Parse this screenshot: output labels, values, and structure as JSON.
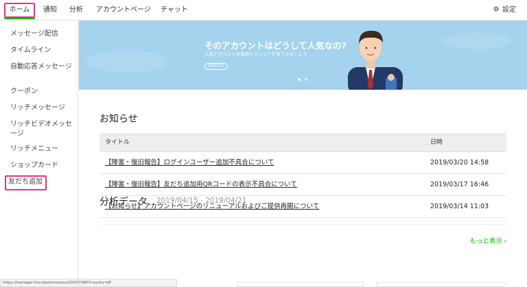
{
  "topnav": {
    "tabs": [
      {
        "label": "ホーム"
      },
      {
        "label": "通知"
      },
      {
        "label": "分析"
      },
      {
        "label": "アカウントページ"
      },
      {
        "label": "チャット"
      }
    ],
    "settings_label": "設定",
    "colors": {
      "highlight": "#e6337a",
      "active_underline": "#00b900"
    }
  },
  "sidebar": {
    "items": [
      {
        "label": "メッセージ配信"
      },
      {
        "label": "タイムライン"
      },
      {
        "label": "自動応答メッセージ"
      },
      {
        "label": "クーポン"
      },
      {
        "label": "リッチメッセージ"
      },
      {
        "label": "リッチビデオメッセージ"
      },
      {
        "label": "リッチメニュー"
      },
      {
        "label": "ショップカード"
      },
      {
        "label": "友だち追加"
      }
    ]
  },
  "banner": {
    "title": "そのアカウントはどうして人気なの?",
    "subtitle": "人気アカウントの運用テクニックを見てみましょう",
    "button_label": "詳細を見る",
    "background": "#a5d3ee"
  },
  "announcements": {
    "title": "お知らせ",
    "columns": {
      "title": "タイトル",
      "date": "日時"
    },
    "rows": [
      {
        "title": "【障害・復旧報告】ログインユーザー追加不具合について",
        "date": "2019/03/20 14:58"
      },
      {
        "title": "【障害・復旧報告】友だち追加用QRコードの表示不具合について",
        "date": "2019/03/17 16:46"
      },
      {
        "title": "【お知らせ】アカウントページのリニューアルおよびご提供再開について",
        "date": "2019/03/14 11:03"
      }
    ],
    "more_label": "もっと表示",
    "accent": "#00b900"
  },
  "analytics": {
    "title": "分析データ",
    "date_range": "2019/04/15 - 2019/04/21"
  },
  "statusbar": {
    "url": "https://manager.line.biz/announce/201070967country=JP"
  }
}
